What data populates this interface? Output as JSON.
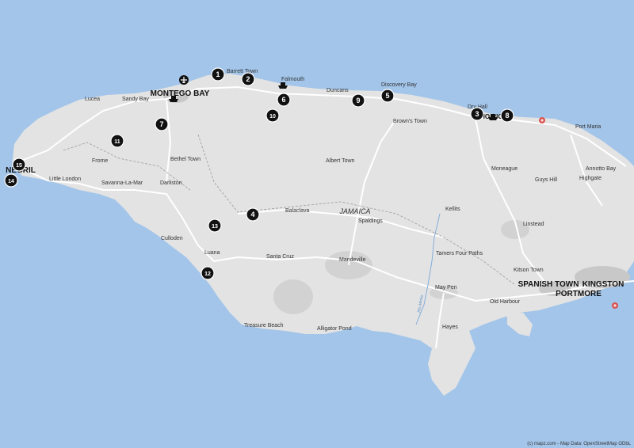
{
  "map": {
    "attribution": "(c) mapz.com - Map Data: OpenStreetMap ODbL",
    "colors": {
      "sea": "#a3c5ea",
      "land": "#e3e3e3",
      "urban": "#c8c8c8",
      "road": "#ffffff",
      "marker": "#111111",
      "hospital": "#d9534f"
    }
  },
  "region_label": "JAMAICA",
  "cities": [
    {
      "name": "MONTEGO BAY",
      "major": true
    },
    {
      "name": "NEGRIL",
      "major": true
    },
    {
      "name": "SPANISH TOWN",
      "major": true
    },
    {
      "name": "KINGSTON",
      "major": true
    },
    {
      "name": "PORTMORE",
      "major": true
    },
    {
      "name": "OCHO RIOS",
      "major": true
    }
  ],
  "towns": [
    "Lucea",
    "Sandy Bay",
    "Barrett Town",
    "Falmouth",
    "Duncans",
    "Discovery Bay",
    "Dry Hall",
    "Brown's Town",
    "Port Maria",
    "Annotto Bay",
    "Highgate",
    "Guys Hill",
    "Moneague",
    "Linstead",
    "Kellits",
    "Spaldings",
    "Balaclava",
    "Albert Town",
    "Frome",
    "Bethel Town",
    "Little London",
    "Savanna-La-Mar",
    "Darliston",
    "Culloden",
    "Luana",
    "Santa Cruz",
    "Mandeville",
    "Tamers Four Paths",
    "Kitson Town",
    "May Pen",
    "Old Harbour",
    "Hayes",
    "Alligator Pond",
    "Treasure Beach"
  ],
  "river": "Rio Minho",
  "markers": [
    "1",
    "2",
    "3",
    "4",
    "5",
    "6",
    "7",
    "8",
    "9",
    "10",
    "11",
    "12",
    "13",
    "14",
    "15"
  ],
  "icons": [
    "airport-icon",
    "ferry-icon",
    "hospital-icon"
  ]
}
